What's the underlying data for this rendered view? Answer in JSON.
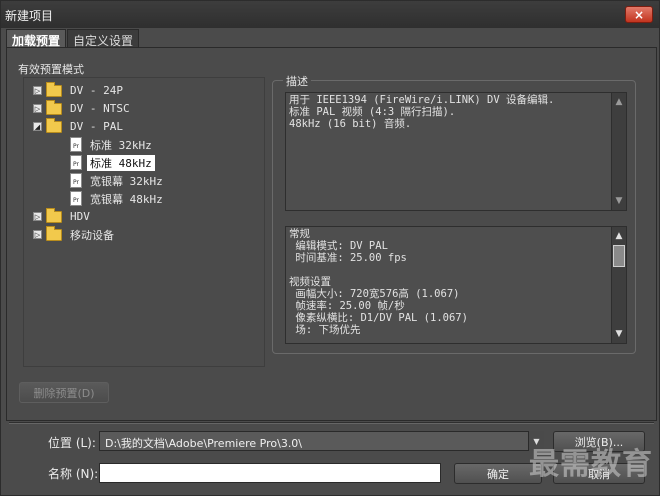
{
  "window": {
    "title": "新建项目",
    "close_label": "×"
  },
  "tabs": [
    {
      "label": "加载预置",
      "active": true
    },
    {
      "label": "自定义设置",
      "active": false
    }
  ],
  "presets": {
    "label": "有效预置模式",
    "items": [
      {
        "label": "DV - 24P",
        "type": "folder",
        "expander": "▷"
      },
      {
        "label": "DV - NTSC",
        "type": "folder",
        "expander": "▷"
      },
      {
        "label": "DV - PAL",
        "type": "folder",
        "expander": "◢"
      },
      {
        "label": "标准 32kHz",
        "type": "file"
      },
      {
        "label": "标准 48kHz",
        "type": "file",
        "selected": true
      },
      {
        "label": "宽银幕 32kHz",
        "type": "file"
      },
      {
        "label": "宽银幕 48kHz",
        "type": "file"
      },
      {
        "label": "HDV",
        "type": "folder",
        "expander": "▷"
      },
      {
        "label": "移动设备",
        "type": "folder",
        "expander": "▷"
      }
    ],
    "file_icon_text": "Pr",
    "delete_button": "删除预置(D)"
  },
  "description": {
    "legend": "描述",
    "summary_lines": [
      "用于 IEEE1394 (FireWire/i.LINK) DV 设备编辑.",
      "标准 PAL 视频 (4:3 隔行扫描).",
      "48kHz (16 bit) 音频."
    ],
    "details_lines": [
      "常规",
      " 编辑模式: DV PAL",
      " 时间基准: 25.00 fps",
      "",
      "视频设置",
      " 画幅大小: 720宽576高 (1.067)",
      " 帧速率: 25.00 帧/秒",
      " 像素纵横比: D1/DV PAL (1.067)",
      " 场: 下场优先"
    ]
  },
  "location": {
    "label": "位置 (L):",
    "value": "D:\\我的文档\\Adobe\\Premiere Pro\\3.0\\",
    "browse_button": "浏览(B)..."
  },
  "name": {
    "label": "名称 (N):",
    "value": ""
  },
  "ok_button": "确定",
  "cancel_button": "取消",
  "watermark": "最需教育"
}
